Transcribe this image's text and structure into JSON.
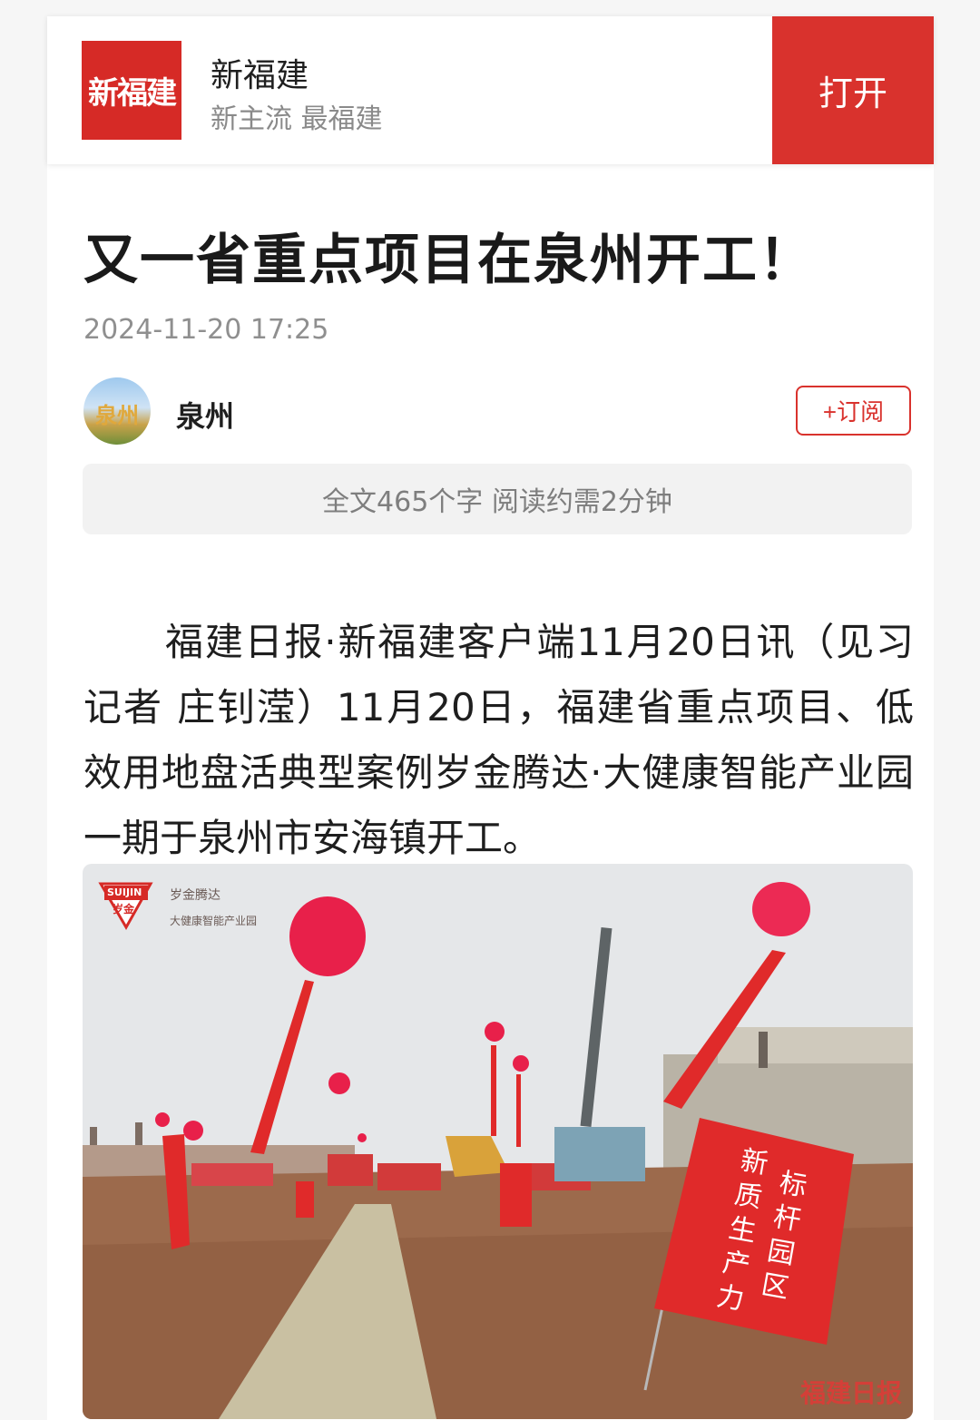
{
  "app_banner": {
    "logo_text": "新福建",
    "app_name": "新福建",
    "slogan": "新主流 最福建",
    "open_button": "打开"
  },
  "article": {
    "title": "又一省重点项目在泉州开工！",
    "datetime": "2024-11-20 17:25",
    "source": {
      "avatar_text": "泉州",
      "name": "泉州",
      "subscribe_label": "+订阅"
    },
    "read_info": "全文465个字 阅读约需2分钟",
    "paragraph": "福建日报·新福建客户端11月20日讯（见习记者 庄钊滢）11月20日，福建省重点项目、低效用地盘活典型案例岁金腾达·大健康智能产业园一期于泉州市安海镇开工。"
  },
  "photo": {
    "corner_logo_brand": "SUIJIN",
    "corner_logo_badge": "岁金",
    "corner_logo_title": "岁金腾达",
    "corner_logo_subtitle": "大健康智能产业园",
    "flag_line1": "新质生产力",
    "flag_line2": "标杆园区",
    "watermark": "福建日报",
    "colors": {
      "balloon": "#e8204a",
      "flag": "#e02a2a",
      "soil": "#9c6a4c",
      "sky": "#e6e8ea"
    }
  }
}
